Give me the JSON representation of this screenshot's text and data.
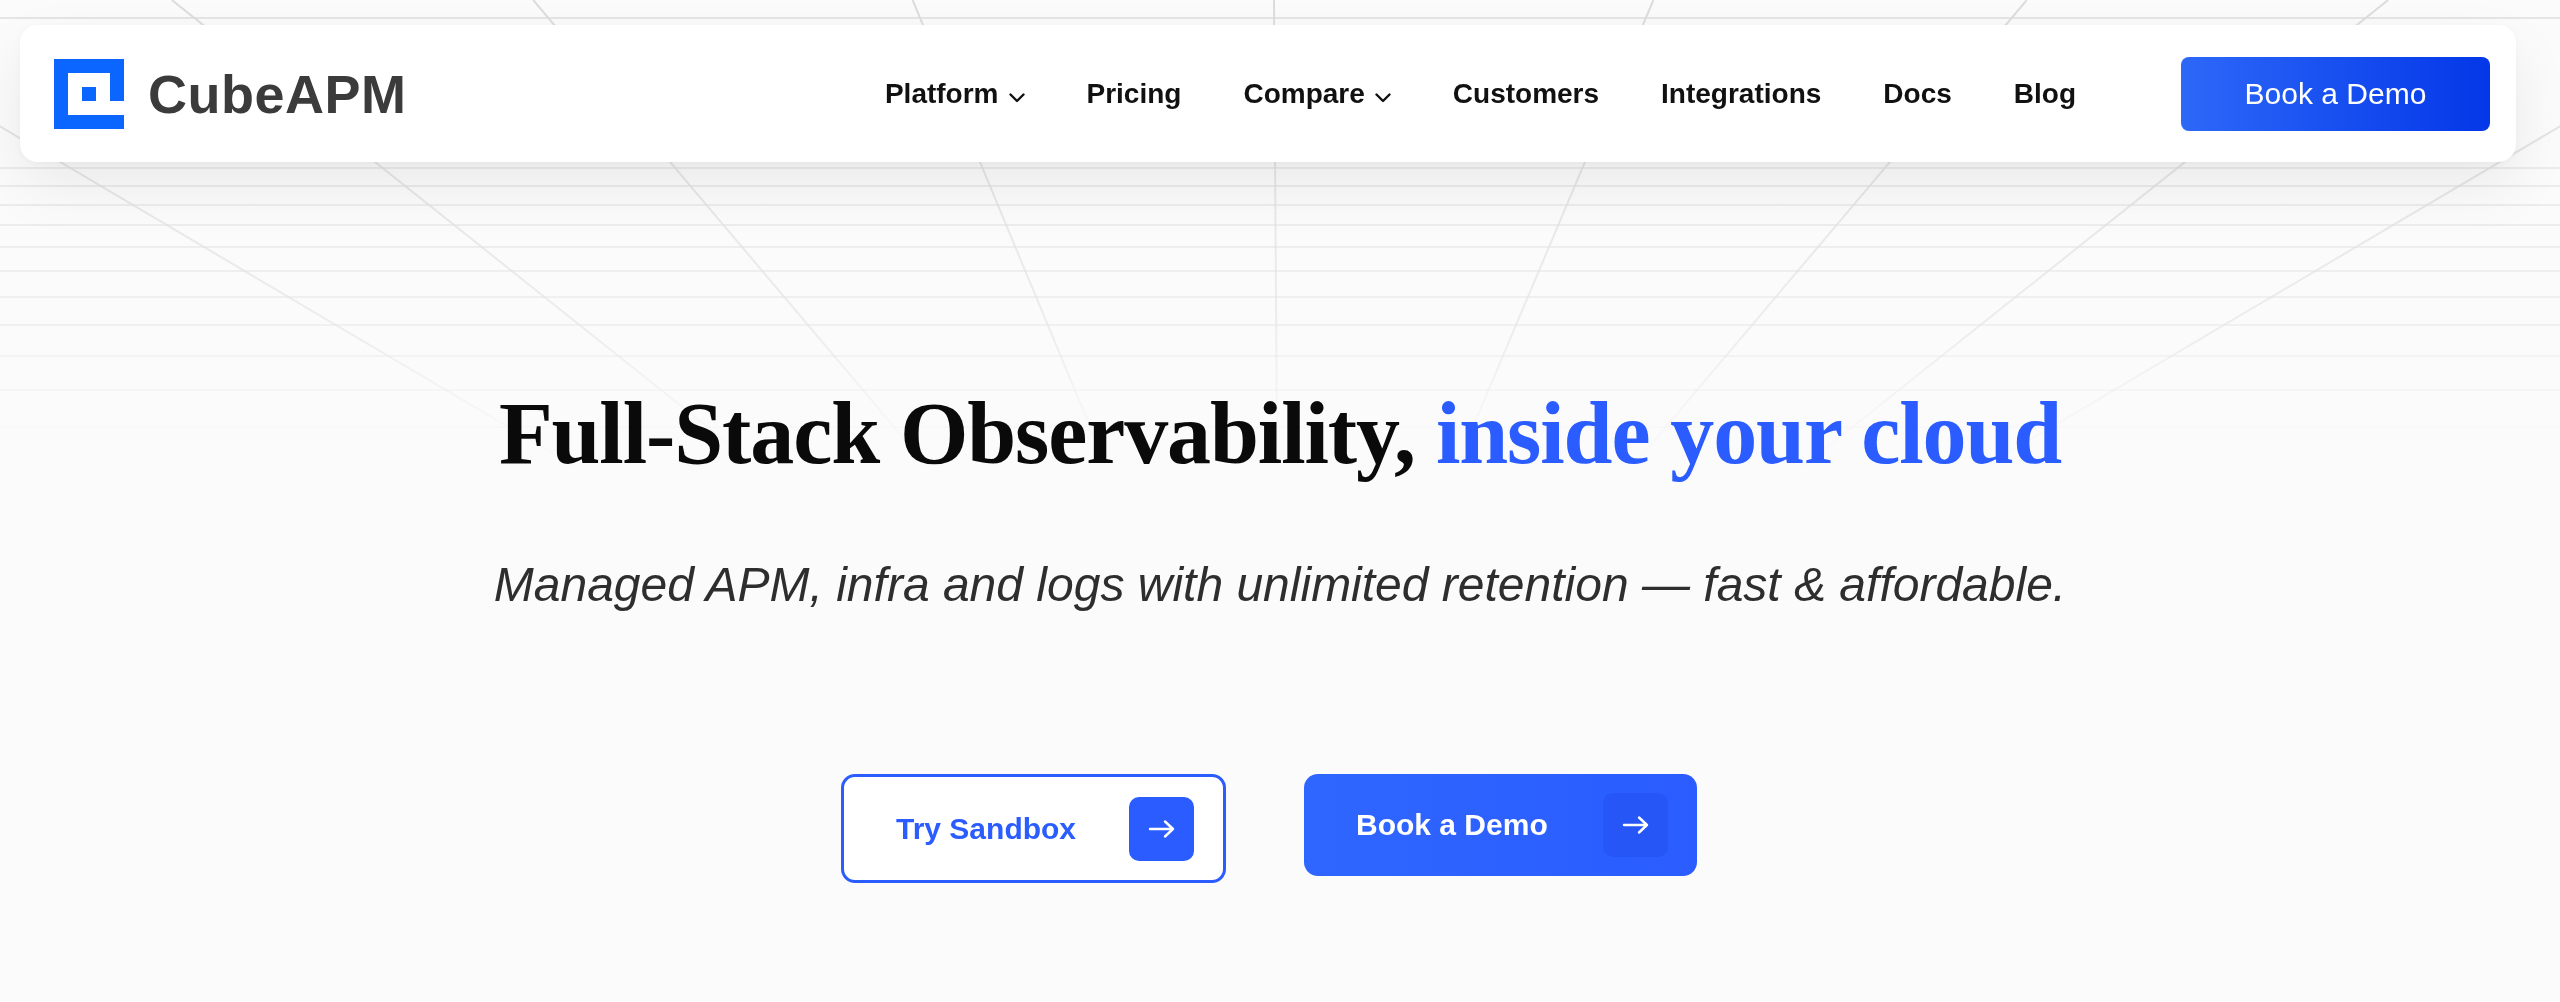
{
  "header": {
    "logo": {
      "text": "CubeAPM"
    },
    "nav": [
      {
        "label": "Platform",
        "has_menu": true
      },
      {
        "label": "Pricing",
        "has_menu": false
      },
      {
        "label": "Compare",
        "has_menu": true
      },
      {
        "label": "Customers",
        "has_menu": false
      },
      {
        "label": "Integrations",
        "has_menu": false
      },
      {
        "label": "Docs",
        "has_menu": false
      },
      {
        "label": "Blog",
        "has_menu": false
      }
    ],
    "cta": {
      "label": "Book a Demo"
    }
  },
  "hero": {
    "title": [
      {
        "text": "Full-Stack Observability,",
        "highlight": false
      },
      {
        "text": "inside your cloud",
        "highlight": true
      }
    ],
    "subtitle": "Managed APM, infra and logs with unlimited retention — fast & affordable.",
    "buttons": [
      {
        "label": "Try Sandbox",
        "kind": "outline"
      },
      {
        "label": "Book a Demo",
        "kind": "filled"
      }
    ]
  }
}
